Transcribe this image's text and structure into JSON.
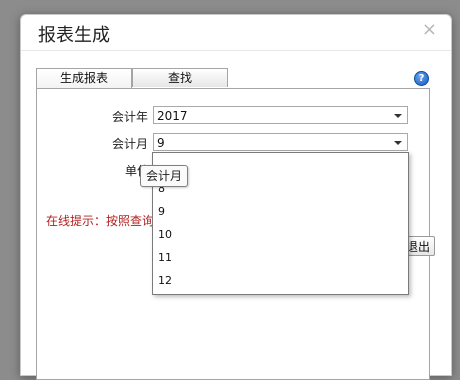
{
  "dialog": {
    "title": "报表生成",
    "close_glyph": "×"
  },
  "tabs": [
    {
      "label": "生成报表",
      "active": true
    },
    {
      "label": "查找",
      "active": false
    }
  ],
  "help_glyph": "?",
  "form": {
    "year_label": "会计年",
    "year_value": "2017",
    "month_label": "会计月",
    "month_value": "9",
    "unit_label": "单位"
  },
  "hint": "在线提示：按照查询条",
  "exit_button_label": "退出",
  "tooltip": "会计月",
  "dropdown_options": [
    "8",
    "9",
    "10",
    "11",
    "12"
  ],
  "colors": {
    "hint": "#b22222",
    "help_icon": "#1459c0"
  }
}
